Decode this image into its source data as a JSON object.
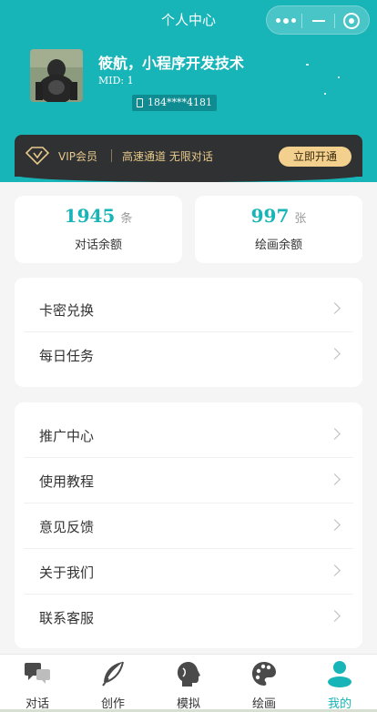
{
  "header": {
    "title": "个人中心"
  },
  "profile": {
    "name": "筱航，小程序开发技术",
    "mid": "MID: 1",
    "phone": "184****4181"
  },
  "vip": {
    "label": "VIP会员",
    "desc": "高速通道 无限对话",
    "button": "立即开通",
    "colors": {
      "background": "#2f3133",
      "gold": "#e8c98a",
      "button": "#f3d08d"
    }
  },
  "stats": [
    {
      "value": "1945",
      "unit": "条",
      "label": "对话余额"
    },
    {
      "value": "997",
      "unit": "张",
      "label": "绘画余额"
    }
  ],
  "menu1": [
    {
      "label": "卡密兑换"
    },
    {
      "label": "每日任务"
    }
  ],
  "menu2": [
    {
      "label": "推广中心"
    },
    {
      "label": "使用教程"
    },
    {
      "label": "意见反馈"
    },
    {
      "label": "关于我们"
    },
    {
      "label": "联系客服"
    }
  ],
  "tabs": [
    {
      "label": "对话",
      "icon": "chat-icon"
    },
    {
      "label": "创作",
      "icon": "feather-icon"
    },
    {
      "label": "模拟",
      "icon": "head-profile-icon"
    },
    {
      "label": "绘画",
      "icon": "palette-icon"
    },
    {
      "label": "我的",
      "icon": "user-icon",
      "active": true
    }
  ],
  "colors": {
    "accent": "#17b4b8",
    "page_bg": "#f5f5f5"
  }
}
